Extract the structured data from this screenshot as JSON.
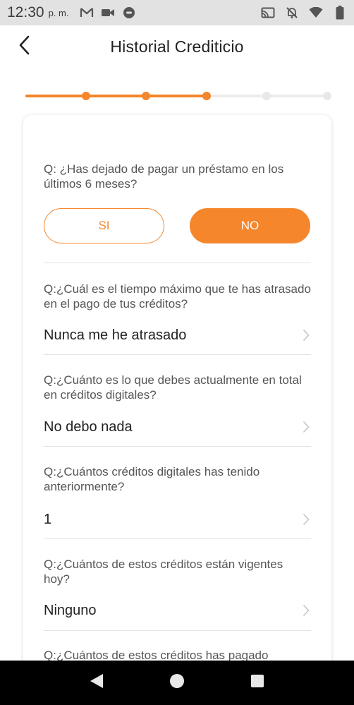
{
  "status_bar": {
    "time": "12:30",
    "ampm": "p. m."
  },
  "header": {
    "title": "Historial Crediticio"
  },
  "progress": {
    "total_steps": 6,
    "completed_steps": 4,
    "completed_fraction": 0.6
  },
  "questions": {
    "q1": {
      "text": "Q: ¿Has dejado de pagar un préstamo en los últimos 6 meses?",
      "options": [
        "SI",
        "NO"
      ],
      "selected": "NO"
    },
    "q2": {
      "text": "Q:¿Cuál es el tiempo máximo que te has atrasado en el pago de tus créditos?",
      "answer": "Nunca me he atrasado"
    },
    "q3": {
      "text": "Q:¿Cuánto es lo que debes actualmente en total en créditos digitales?",
      "answer": "No debo nada"
    },
    "q4": {
      "text": "Q:¿Cuántos créditos digitales has tenido anteriormente?",
      "answer": "1"
    },
    "q5": {
      "text": "Q:¿Cuántos de estos créditos están vigentes hoy?",
      "answer": "Ninguno"
    },
    "q6": {
      "text": "Q:¿Cuántos de estos créditos has pagado"
    }
  },
  "colors": {
    "accent": "#f5862b",
    "status_bar": "#e2e2e2",
    "nav_bar": "#000000"
  },
  "icons": {
    "back": "chevron-left-icon",
    "row": "chevron-right-icon"
  }
}
